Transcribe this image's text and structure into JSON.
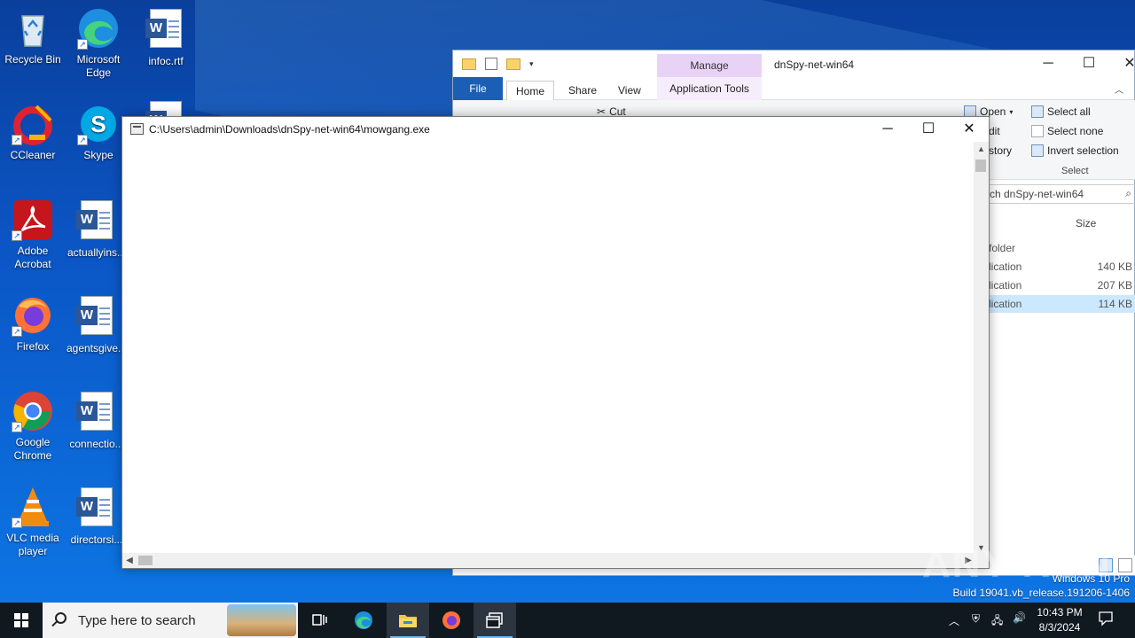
{
  "desktop": {
    "icons": [
      {
        "label": "Recycle Bin",
        "icon": "recycle-bin-icon"
      },
      {
        "label": "Microsoft Edge",
        "icon": "edge-icon"
      },
      {
        "label": "infoc.rtf",
        "icon": "word-doc-icon"
      },
      {
        "label": "CCleaner",
        "icon": "ccleaner-icon"
      },
      {
        "label": "Skype",
        "icon": "skype-icon"
      },
      {
        "label": "Adobe Acrobat",
        "icon": "acrobat-icon"
      },
      {
        "label": "actuallyins...",
        "icon": "word-doc-icon"
      },
      {
        "label": "Firefox",
        "icon": "firefox-icon"
      },
      {
        "label": "agentsgive...",
        "icon": "word-doc-icon"
      },
      {
        "label": "Google Chrome",
        "icon": "chrome-icon"
      },
      {
        "label": "connectio...",
        "icon": "word-doc-icon"
      },
      {
        "label": "VLC media player",
        "icon": "vlc-icon"
      },
      {
        "label": "directorsi...",
        "icon": "word-doc-icon"
      }
    ]
  },
  "explorer": {
    "title": "dnSpy-net-win64",
    "manage_tab": "Manage",
    "tabs": {
      "file": "File",
      "home": "Home",
      "share": "Share",
      "view": "View",
      "app_tools": "Application Tools"
    },
    "ribbon": {
      "cut": "Cut",
      "open": "Open",
      "edit": "dit",
      "history": "story",
      "select_all": "Select all",
      "select_none": "Select none",
      "invert_selection": "Invert selection",
      "select_group": "Select"
    },
    "search_placeholder": "ch dnSpy-net-win64",
    "column_size": "Size",
    "rows": [
      {
        "type": "folder",
        "size": ""
      },
      {
        "type": "lication",
        "size": "140 KB"
      },
      {
        "type": "lication",
        "size": "207 KB"
      },
      {
        "type": "lication",
        "size": "114 KB"
      }
    ]
  },
  "appwindow": {
    "title": "C:\\Users\\admin\\Downloads\\dnSpy-net-win64\\mowgang.exe"
  },
  "watermark": {
    "text": "ANY RUN",
    "edition": "Windows 10 Pro",
    "build": "Build 19041.vb_release.191206-1406"
  },
  "taskbar": {
    "search_placeholder": "Type here to search",
    "time": "10:43 PM",
    "date": "8/3/2024"
  }
}
